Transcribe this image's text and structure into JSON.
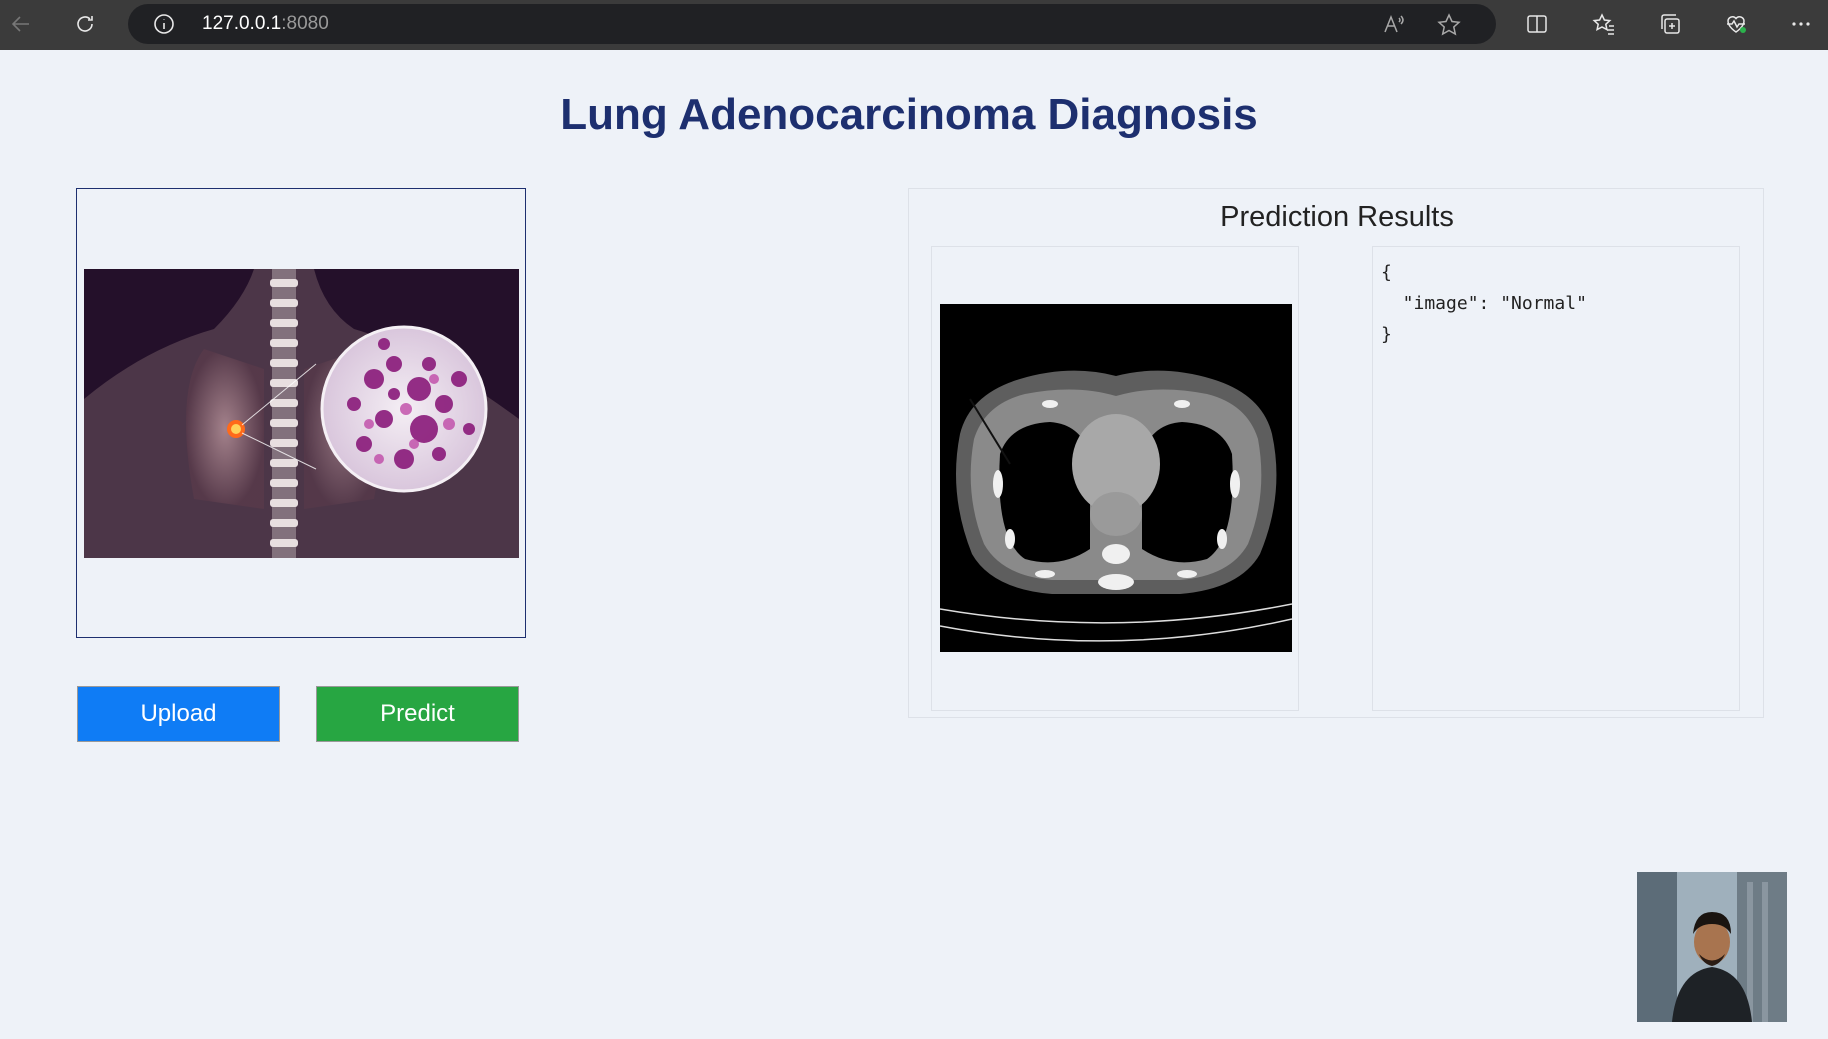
{
  "browser": {
    "url_host": "127.0.0.1",
    "url_port": ":8080",
    "icons": [
      "back-icon",
      "refresh-icon",
      "info-icon",
      "read-aloud-icon",
      "favorite-star-icon",
      "split-screen-icon",
      "favorites-icon",
      "collections-icon",
      "performance-icon",
      "more-icon"
    ]
  },
  "page": {
    "title": "Lung Adenocarcinoma Diagnosis"
  },
  "buttons": {
    "upload": "Upload",
    "predict": "Predict"
  },
  "results": {
    "title": "Prediction Results",
    "json_text": "{\n  \"image\": \"Normal\"\n}"
  },
  "colors": {
    "title": "#1d2f6f",
    "upload": "#0f7cf5",
    "predict": "#27a642",
    "chrome": "#3b3b3b"
  }
}
